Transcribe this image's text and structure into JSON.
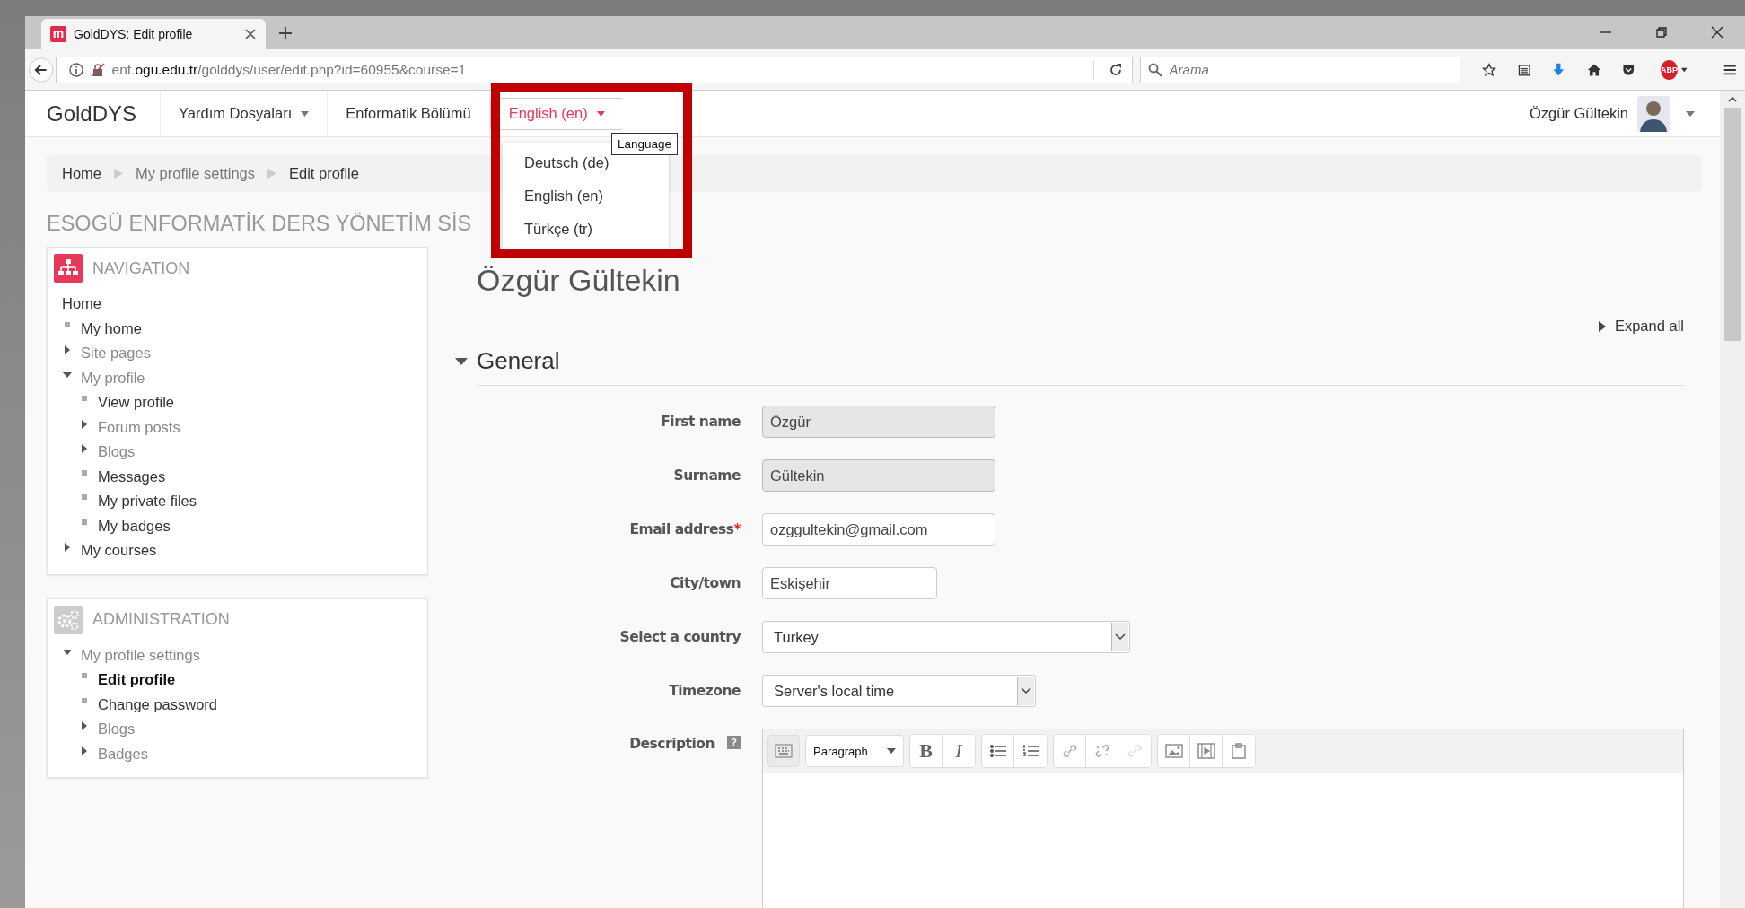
{
  "browser": {
    "tab": {
      "favicon_letter": "m",
      "title": "GoldDYS: Edit profile"
    },
    "url": {
      "host_prefix": "enf.",
      "host": "ogu.edu.tr",
      "path": "/golddys/user/edit.php?id=60955&course=1"
    },
    "search": {
      "placeholder": "Arama"
    },
    "adblock_label": "ABP"
  },
  "navbar": {
    "brand": "GoldDYS",
    "items": [
      {
        "label": "Yardım Dosyaları",
        "dropdown": true,
        "selected": false
      },
      {
        "label": "Enformatik Bölümü",
        "dropdown": false,
        "selected": false
      },
      {
        "label": "English (en)",
        "dropdown": true,
        "selected": true
      }
    ],
    "user": {
      "name": "Özgür Gültekin"
    }
  },
  "language_menu": {
    "items": [
      "Deutsch (de)",
      "English (en)",
      "Türkçe (tr)"
    ],
    "tooltip": "Language"
  },
  "breadcrumb": [
    "Home",
    "My profile settings",
    "Edit profile"
  ],
  "site_heading": "ESOGÜ ENFORMATİK DERS YÖNETİM SİS",
  "blocks": [
    {
      "kind": "navigation",
      "title": "NAVIGATION",
      "tree": [
        {
          "label": "Home",
          "kind": "plain",
          "link": true,
          "current": false
        },
        {
          "label": "My home",
          "kind": "leaf",
          "link": true,
          "current": false
        },
        {
          "label": "Site pages",
          "kind": "branch",
          "expanded": false,
          "link": false,
          "current": false
        },
        {
          "label": "My profile",
          "kind": "branch",
          "expanded": true,
          "link": false,
          "current": false,
          "children": [
            {
              "label": "View profile",
              "kind": "leaf",
              "link": true,
              "current": false
            },
            {
              "label": "Forum posts",
              "kind": "branch",
              "expanded": false,
              "link": false,
              "current": false
            },
            {
              "label": "Blogs",
              "kind": "branch",
              "expanded": false,
              "link": false,
              "current": false
            },
            {
              "label": "Messages",
              "kind": "leaf",
              "link": true,
              "current": false
            },
            {
              "label": "My private files",
              "kind": "leaf",
              "link": true,
              "current": false
            },
            {
              "label": "My badges",
              "kind": "leaf",
              "link": true,
              "current": false
            }
          ]
        },
        {
          "label": "My courses",
          "kind": "branch",
          "expanded": false,
          "link": true,
          "current": false
        }
      ]
    },
    {
      "kind": "administration",
      "title": "ADMINISTRATION",
      "tree": [
        {
          "label": "My profile settings",
          "kind": "branch",
          "expanded": true,
          "link": false,
          "current": false,
          "children": [
            {
              "label": "Edit profile",
              "kind": "leaf",
              "link": true,
              "current": true
            },
            {
              "label": "Change password",
              "kind": "leaf",
              "link": true,
              "current": false
            },
            {
              "label": "Blogs",
              "kind": "branch",
              "expanded": false,
              "link": false,
              "current": false
            },
            {
              "label": "Badges",
              "kind": "branch",
              "expanded": false,
              "link": false,
              "current": false
            }
          ]
        }
      ]
    }
  ],
  "main": {
    "heading": "Özgür Gültekin",
    "expand_all": "Expand all",
    "section": {
      "title": "General",
      "expanded": true
    },
    "fields": [
      {
        "label": "First name",
        "kind": "text",
        "value": "Özgür",
        "disabled": true
      },
      {
        "label": "Surname",
        "kind": "text",
        "value": "Gültekin",
        "disabled": true
      },
      {
        "label": "Email address",
        "required_mark": "*",
        "kind": "text",
        "value": "ozggultekin@gmail.com",
        "disabled": false
      },
      {
        "label": "City/town",
        "kind": "text",
        "value": "Eskişehir",
        "disabled": false
      },
      {
        "label": "Select a country",
        "kind": "select",
        "value": "Turkey",
        "disabled": false
      },
      {
        "label": "Timezone",
        "kind": "select",
        "value": "Server's local time",
        "disabled": false
      },
      {
        "label": "Description",
        "kind": "editor",
        "help_label": "?",
        "format": "Paragraph",
        "bold_label": "B",
        "italic_label": "I"
      }
    ]
  }
}
